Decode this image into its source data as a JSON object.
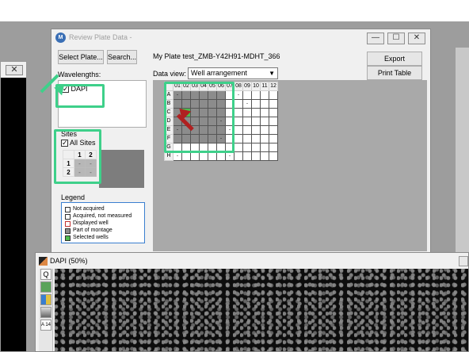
{
  "review_window": {
    "title": "Review Plate Data -",
    "app_icon_letter": "M",
    "minimize": "—",
    "maximize": "☐",
    "close": "✕",
    "select_plate_button": "Select Plate...",
    "search_button": "Search...",
    "plate_name": "My Plate test_ZMB-Y42H91-MDHT_366",
    "export_protocol_button": "Export Protocol...",
    "print_table_button": "Print Table",
    "wavelengths_label": "Wavelengths:",
    "wavelength_item": "DAPI",
    "data_view_label": "Data view:",
    "data_view_value": "Well arrangement",
    "sites_label": "Sites",
    "all_sites_label": "All Sites",
    "sites_cols": [
      "1",
      "2"
    ],
    "sites_rows": [
      "1",
      "2"
    ],
    "sites_cell_marker": "-",
    "legend_title": "Legend",
    "legend_items": [
      "Not acquired",
      "Acquired, not measured",
      "Displayed well",
      "Part of montage",
      "Selected wells"
    ]
  },
  "plate": {
    "columns": [
      "01",
      "02",
      "03",
      "04",
      "05",
      "06",
      "07",
      "08",
      "09",
      "10",
      "11",
      "12"
    ],
    "rows": [
      "A",
      "B",
      "C",
      "D",
      "E",
      "F",
      "G",
      "H"
    ],
    "measured_marker": "-"
  },
  "bg_window_close": "✕",
  "dapi_window": {
    "title": "DAPI (50%)",
    "tools": [
      "Q",
      "",
      "",
      "",
      "A 14"
    ]
  },
  "colors": {
    "highlight": "#3ed08a",
    "arrow_red": "#b02020",
    "selected_well": "#4dbb4d",
    "montage_well": "#8c8c8c"
  }
}
